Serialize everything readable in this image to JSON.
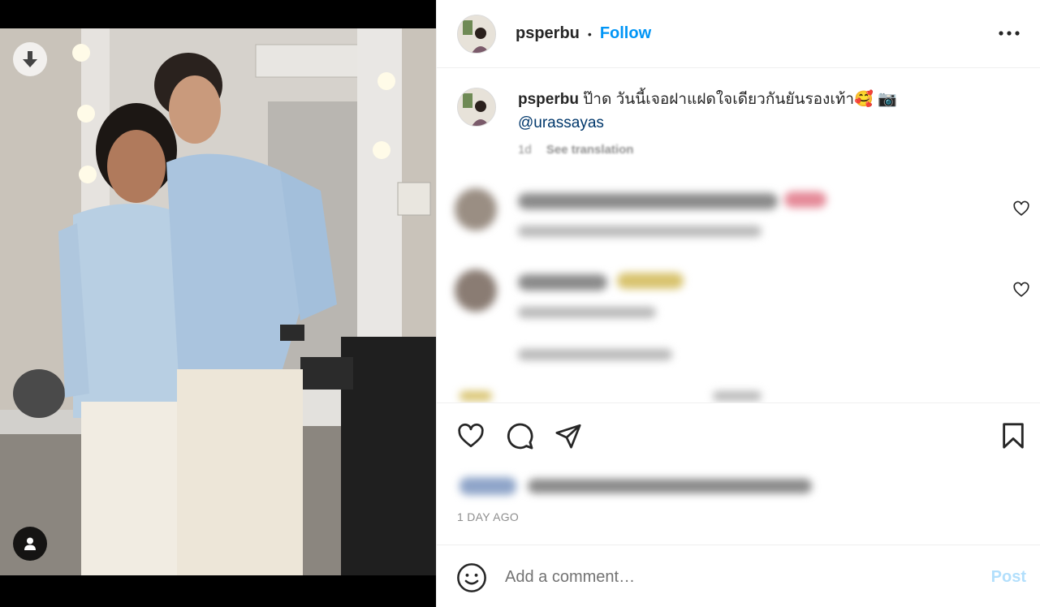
{
  "media": {
    "download_icon": "download-arrow-icon",
    "tag_icon": "user-tag-icon"
  },
  "header": {
    "username": "psperbu",
    "separator": "•",
    "follow_label": "Follow",
    "more_icon": "more-horizontal-icon"
  },
  "caption": {
    "username": "psperbu",
    "text": "ป๊าด วันนี้เจอฝาแฝดใจเดียวกันยันรองเท้า🥰 📷",
    "mention": "@urassayas",
    "age": "1d",
    "see_translation": "See translation"
  },
  "actions": {
    "like_icon": "heart-icon",
    "comment_icon": "comment-icon",
    "share_icon": "send-icon",
    "save_icon": "bookmark-icon"
  },
  "timestamp": "1 DAY AGO",
  "comment_box": {
    "emoji_icon": "smiley-icon",
    "placeholder": "Add a comment…",
    "post_label": "Post"
  }
}
